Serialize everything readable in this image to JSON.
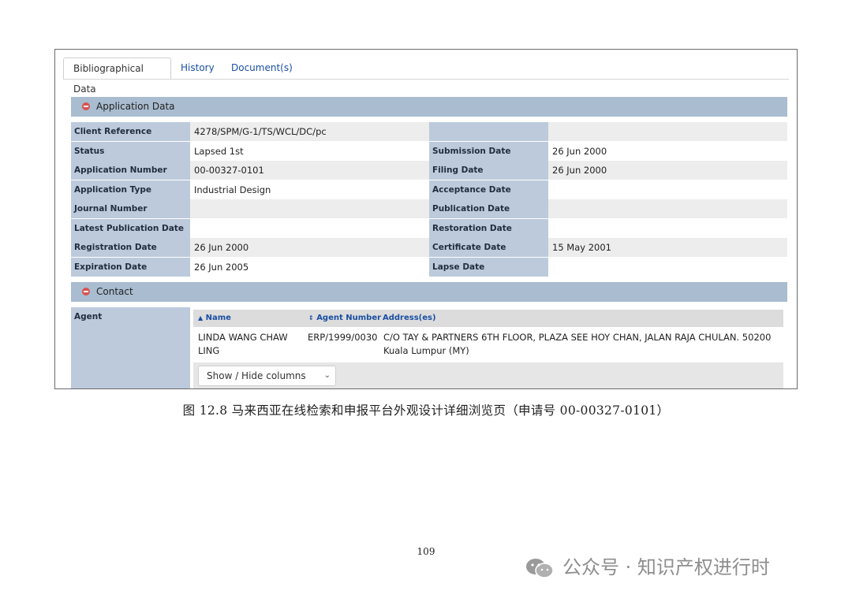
{
  "tabs": [
    "Bibliographical Data",
    "History",
    "Document(s)"
  ],
  "application_section": "Application Data",
  "contact_section": "Contact",
  "left_fields": [
    {
      "label": "Client Reference",
      "value": "4278/SPM/G-1/TS/WCL/DC/pc"
    },
    {
      "label": "Status",
      "value": "Lapsed 1st"
    },
    {
      "label": "Application Number",
      "value": "00-00327-0101"
    },
    {
      "label": "Application Type",
      "value": "Industrial Design"
    },
    {
      "label": "Journal Number",
      "value": ""
    },
    {
      "label": "Latest Publication Date",
      "value": ""
    },
    {
      "label": "Registration Date",
      "value": "26 Jun 2000"
    },
    {
      "label": "Expiration Date",
      "value": "26 Jun 2005"
    }
  ],
  "right_fields": [
    {
      "label": "",
      "value": ""
    },
    {
      "label": "Submission Date",
      "value": "26 Jun 2000"
    },
    {
      "label": "Filing Date",
      "value": "26 Jun 2000"
    },
    {
      "label": "Acceptance Date",
      "value": ""
    },
    {
      "label": "Publication Date",
      "value": ""
    },
    {
      "label": "Restoration Date",
      "value": ""
    },
    {
      "label": "Certificate Date",
      "value": "15 May 2001"
    },
    {
      "label": "Lapse Date",
      "value": ""
    }
  ],
  "agent": {
    "label": "Agent",
    "columns": [
      "Name",
      "Agent Number",
      "Address(es)"
    ],
    "row": {
      "name_line1": "LINDA WANG CHAW",
      "name_line2": "LING",
      "agent_number": "ERP/1999/0030",
      "address_line1": "C/O TAY & PARTNERS 6TH FLOOR, PLAZA SEE HOY CHAN, JALAN RAJA CHULAN. 50200",
      "address_line2": "Kuala Lumpur (MY)"
    },
    "columns_button": "Show / Hide columns"
  },
  "caption": "图 12.8  马来西亚在线检索和申报平台外观设计详细浏览页（申请号 00-00327-0101）",
  "page_number": "109",
  "watermark": "公众号 · 知识产权进行时"
}
